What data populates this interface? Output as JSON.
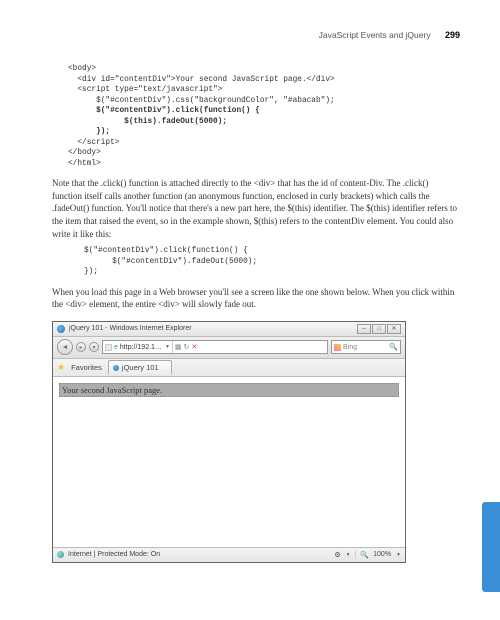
{
  "header": {
    "title": "JavaScript Events and jQuery",
    "page": "299"
  },
  "code1": {
    "l1": "<body>",
    "l2": "  <div id=\"contentDiv\">Your second JavaScript page.</div>",
    "l3": "  <script type=\"text/javascript\">",
    "l4": "      $(\"#contentDiv\").css(\"backgroundColor\", \"#abacab\");",
    "l5": "      $(\"#contentDiv\").click(function() {",
    "l6": "            $(this).fadeOut(5000);",
    "l7": "      });",
    "l8": "  </script>",
    "l9": "</body>",
    "l10": "</html>"
  },
  "para1": "Note that the .click() function is attached directly to the <div> that has the id of content-Div. The .click() function itself calls another function (an anonymous function, enclosed in curly brackets) which calls the .fadeOut() function. You'll notice that there's a new part here, the $(this) identifier. The $(this) identifier refers to the item that raised the event, so in the example shown, $(this) refers to the contentDiv element. You could also write it like this:",
  "code2": {
    "l1": "$(\"#contentDiv\").click(function() {",
    "l2": "      $(\"#contentDiv\").fadeOut(5000);",
    "l3": "});"
  },
  "para2": "When you load this page in a Web browser you'll see a screen like the one shown below. When you click within the <div> element, the entire <div> will slowly fade out.",
  "browser": {
    "title": "jQuery 101 - Windows Internet Explorer",
    "urlPrefix": "http://192.1…",
    "searchPlaceholder": "Bing",
    "favorites": "Favorites",
    "tabTitle": "jQuery 101",
    "contentText": "Your second JavaScript page.",
    "status": "Internet | Protected Mode: On",
    "zoom": "100%"
  }
}
